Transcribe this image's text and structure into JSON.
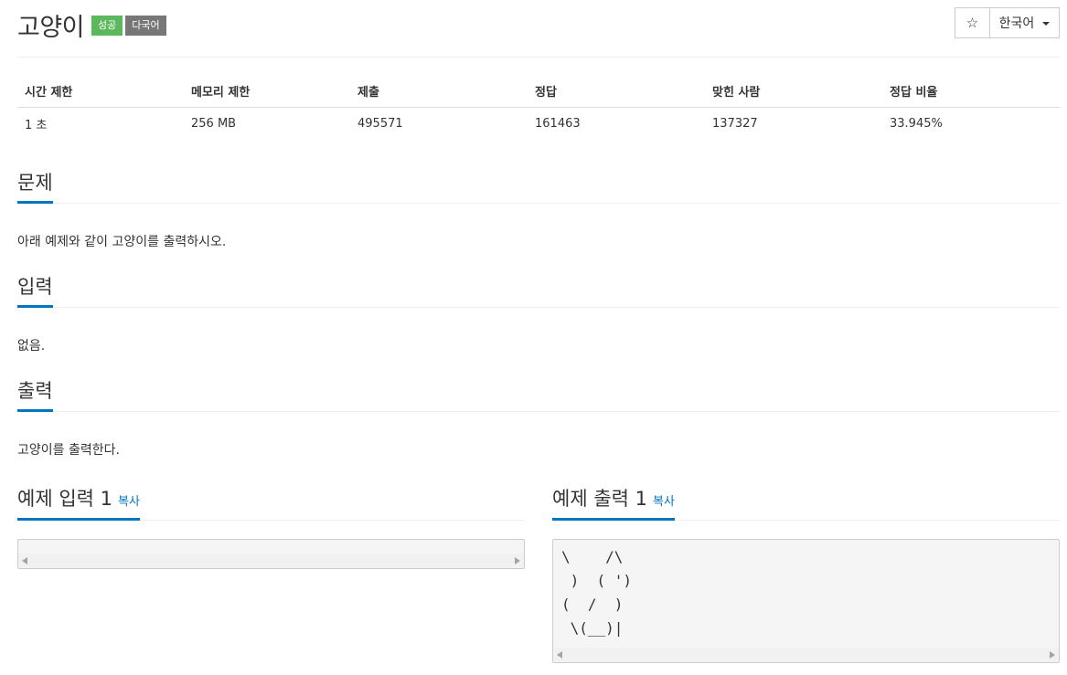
{
  "header": {
    "title": "고양이",
    "badges": {
      "success": "성공",
      "multilang": "다국어"
    },
    "star_icon": "☆",
    "language": "한국어"
  },
  "info_table": {
    "headers": [
      "시간 제한",
      "메모리 제한",
      "제출",
      "정답",
      "맞힌 사람",
      "정답 비율"
    ],
    "row": [
      "1 초",
      "256 MB",
      "495571",
      "161463",
      "137327",
      "33.945%"
    ]
  },
  "sections": {
    "problem": {
      "title": "문제",
      "text": "아래 예제와 같이 고양이를 출력하시오."
    },
    "input": {
      "title": "입력",
      "text": "없음."
    },
    "output": {
      "title": "출력",
      "text": "고양이를 출력한다."
    }
  },
  "examples": {
    "input": {
      "title": "예제 입력 1",
      "copy": "복사",
      "content": ""
    },
    "output": {
      "title": "예제 출력 1",
      "copy": "복사",
      "content": "\\    /\\\n )  ( ')\n(  /  )\n \\(__)|"
    }
  },
  "colors": {
    "accent": "#0076c0",
    "success": "#5cb85c",
    "badge_gray": "#777777"
  }
}
